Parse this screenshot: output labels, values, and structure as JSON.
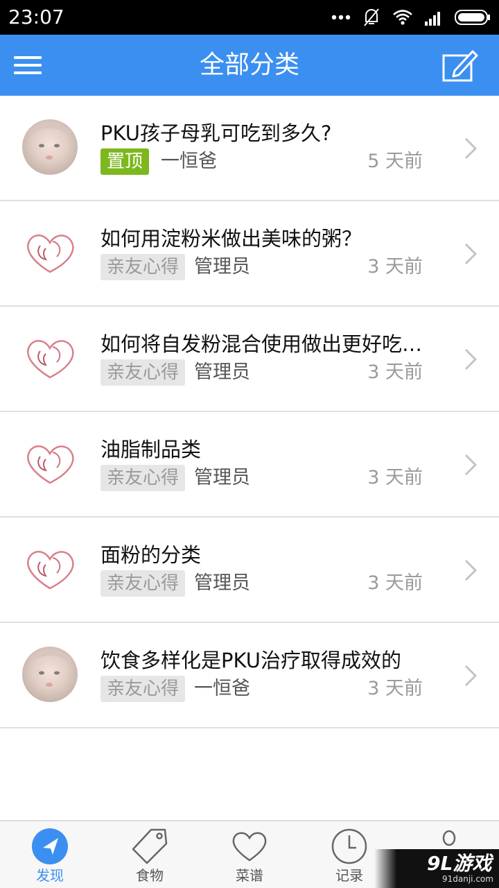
{
  "status_bar": {
    "time": "23:07"
  },
  "app_bar": {
    "title": "全部分类"
  },
  "posts": [
    {
      "title": "PKU孩子母乳可吃到多久?",
      "tag": "置顶",
      "author": "一恒爸",
      "time": "5 天前"
    },
    {
      "title": "如何用淀粉米做出美味的粥？",
      "tag": "亲友心得",
      "author": "管理员",
      "time": "3 天前"
    },
    {
      "title": "如何将自发粉混合使用做出更好吃的面食",
      "tag": "亲友心得",
      "author": "管理员",
      "time": "3 天前"
    },
    {
      "title": "油脂制品类",
      "tag": "亲友心得",
      "author": "管理员",
      "time": "3 天前"
    },
    {
      "title": "面粉的分类",
      "tag": "亲友心得",
      "author": "管理员",
      "time": "3 天前"
    },
    {
      "title": "饮食多样化是PKU治疗取得成效的",
      "tag": "亲友心得",
      "author": "一恒爸",
      "time": "3 天前"
    }
  ],
  "tabs": [
    {
      "label": "发现",
      "icon": "compass-icon",
      "active": true
    },
    {
      "label": "食物",
      "icon": "price-tag-icon"
    },
    {
      "label": "菜谱",
      "icon": "heart-icon"
    },
    {
      "label": "记录",
      "icon": "clock-icon"
    },
    {
      "label": "",
      "icon": "person-icon"
    }
  ],
  "watermark": {
    "logo": "9L游戏",
    "url": "91danji.com"
  },
  "colors": {
    "accent": "#3b8ff0",
    "pinned_tag": "#7cb81e",
    "category_tag_bg": "#e6e6e6"
  }
}
